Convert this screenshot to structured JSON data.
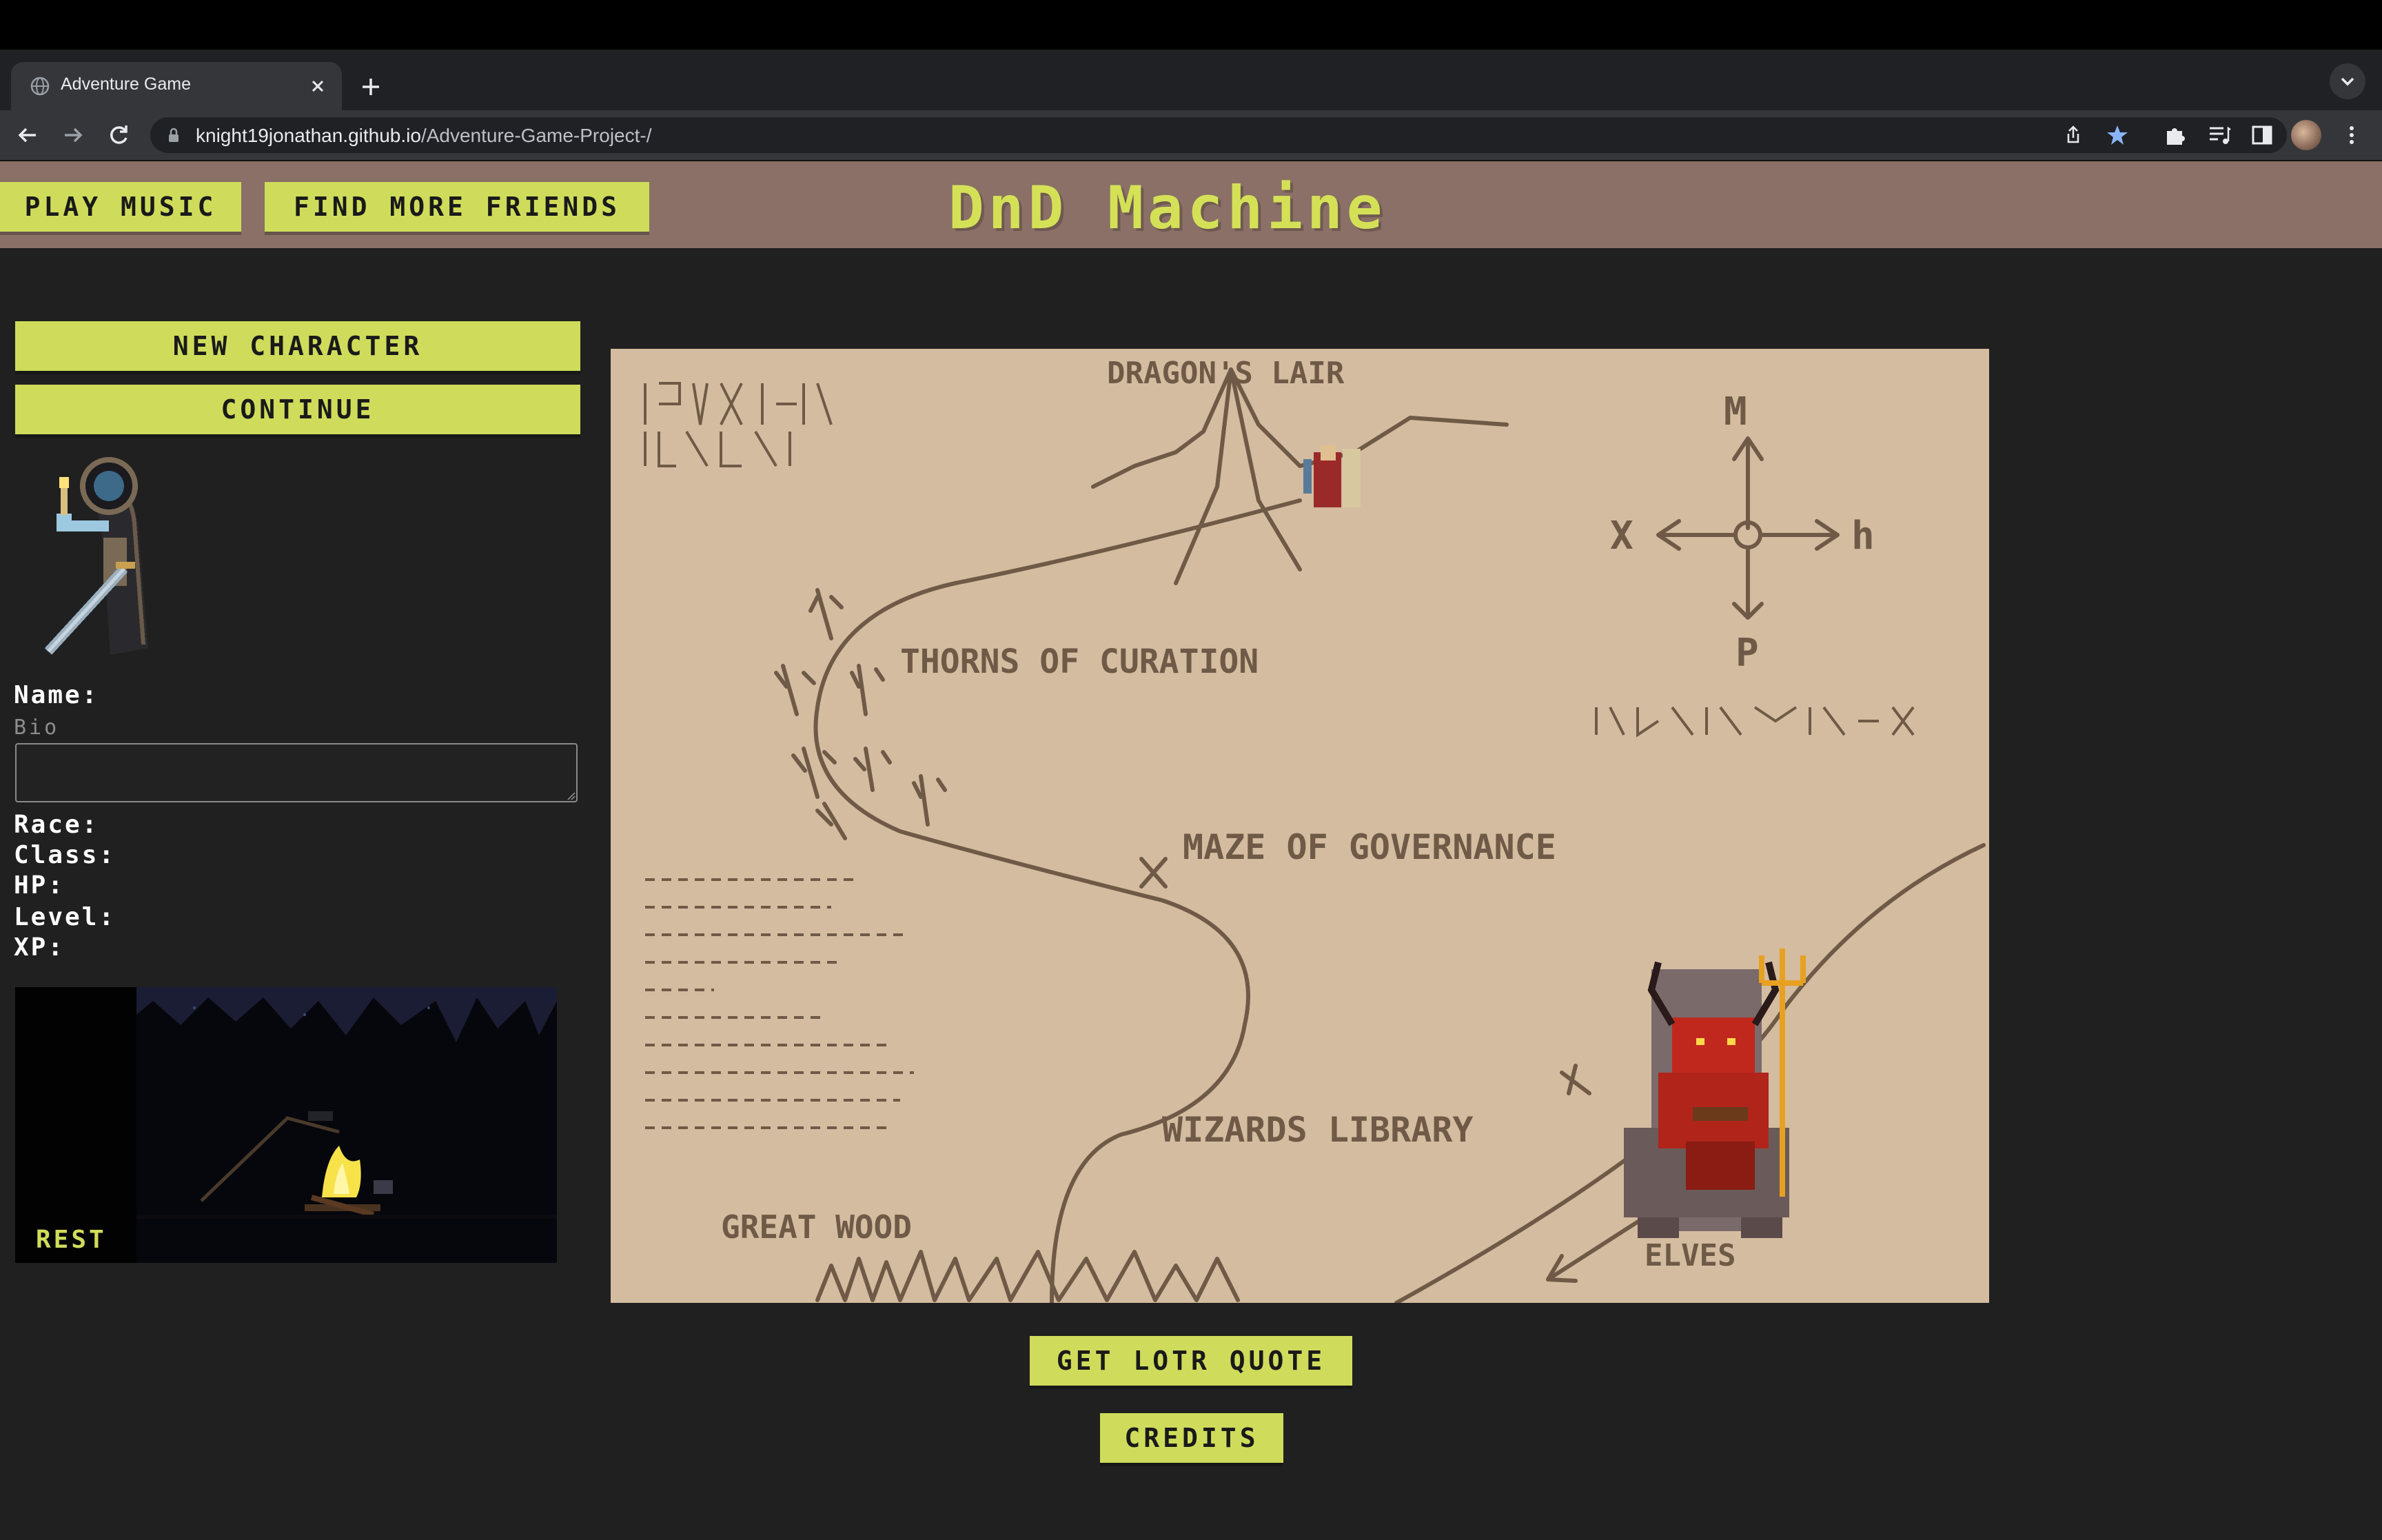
{
  "browser": {
    "tab_title": "Adventure Game",
    "url_host": "knight19jonathan.github.io",
    "url_path": "/Adventure-Game-Project-/"
  },
  "header": {
    "play_music": "PLAY MUSIC",
    "find_friends": "FIND MORE FRIENDS",
    "site_title": "DnD Machine"
  },
  "sidebar": {
    "new_character": "NEW CHARACTER",
    "continue": "CONTINUE",
    "name_label": "Name:",
    "bio_placeholder": "Bio",
    "race_label": "Race:",
    "class_label": "Class:",
    "hp_label": "HP:",
    "level_label": "Level:",
    "xp_label": "XP:",
    "rest_label": "REST"
  },
  "map": {
    "label_dragons_lair": "DRAGON'S LAIR",
    "label_thorns": "THORNS OF CURATION",
    "label_maze": "MAZE OF GOVERNANCE",
    "label_wizards": "WIZARDS LIBRARY",
    "label_great_wood": "GREAT WOOD",
    "label_elves": "ELVES",
    "compass_n": "M",
    "compass_w": "X",
    "compass_e": "h",
    "compass_s": "P"
  },
  "footer": {
    "get_quote": "GET LOTR QUOTE",
    "credits": "CREDITS"
  }
}
